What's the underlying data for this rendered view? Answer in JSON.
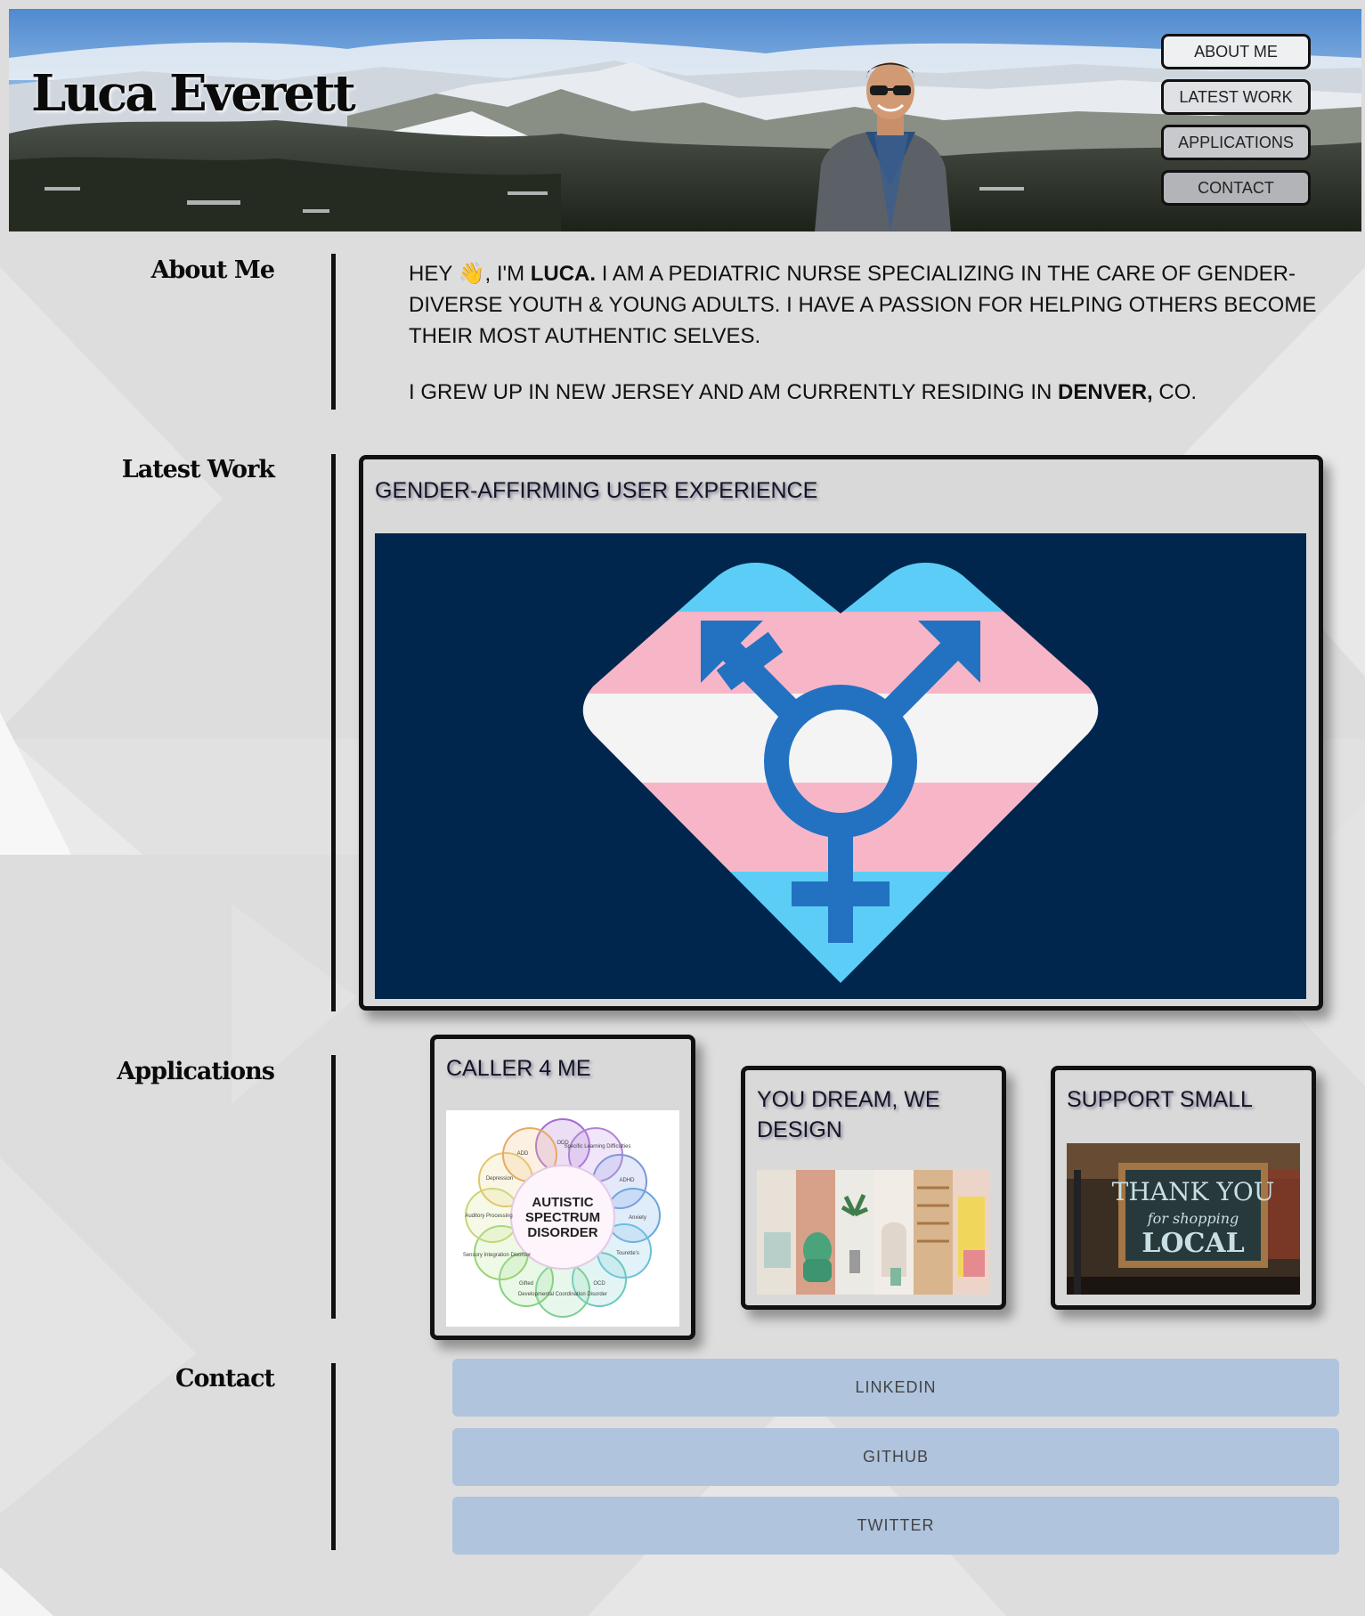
{
  "header": {
    "site_title": "Luca Everett",
    "nav": [
      "ABOUT ME",
      "LATEST WORK",
      "APPLICATIONS",
      "CONTACT"
    ]
  },
  "about": {
    "heading": "About Me",
    "p1_a": "HEY",
    "wave_emoji": "👋",
    "p1_b": ", I'M",
    "name": "LUCA.",
    "p1_c": "I AM A PEDIATRIC NURSE SPECIALIZING IN THE CARE OF GENDER-DIVERSE YOUTH & YOUNG ADULTS. I HAVE A PASSION FOR HELPING OTHERS BECOME THEIR MOST AUTHENTIC SELVES.",
    "p2_a": "I GREW UP IN NEW JERSEY AND AM CURRENTLY RESIDING IN",
    "city": "DENVER,",
    "p2_b": "CO."
  },
  "latest_work": {
    "heading": "Latest Work",
    "card_title": "GENDER-AFFIRMING USER EXPERIENCE",
    "colors": {
      "navy": "#00264d",
      "trans_blue": "#5ccdf6",
      "trans_pink": "#f7b6c8",
      "white": "#f4f4f4",
      "symbol": "#2372c1"
    }
  },
  "applications": {
    "heading": "Applications",
    "cards": [
      {
        "title": "CALLER 4 ME",
        "image_text": [
          "AUTISTIC",
          "SPECTRUM",
          "DISORDER"
        ],
        "bubble_labels": [
          "ADD",
          "ODD",
          "Specific Learning Difficulties",
          "ADHD",
          "Anxiety",
          "Tourette's",
          "OCD",
          "Developmental Coordination Disorder",
          "Gifted",
          "Sensory Integration Disorder",
          "Auditory Processing",
          "Depression"
        ]
      },
      {
        "title": "YOU DREAM, WE DESIGN"
      },
      {
        "title": "SUPPORT SMALL",
        "image_text": [
          "THANK YOU",
          "for shopping",
          "LOCAL"
        ]
      }
    ]
  },
  "contact": {
    "heading": "Contact",
    "links": [
      "LINKEDIN",
      "GITHUB",
      "TWITTER"
    ],
    "button_color": "#b0c4de"
  }
}
